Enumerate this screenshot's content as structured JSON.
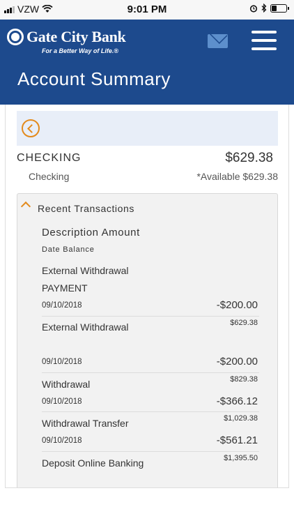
{
  "status_bar": {
    "carrier": "VZW",
    "time": "9:01 PM",
    "battery_level": 0.35,
    "icons": [
      "signal-icon",
      "wifi-icon",
      "alarm-icon",
      "bluetooth-icon",
      "battery-icon"
    ]
  },
  "brand": {
    "bank_name": "Gate City Bank",
    "tagline": "For a Better Way of Life.®",
    "color": "#1d4a8d",
    "accent": "#e38a1c"
  },
  "header": {
    "title": "Account Summary"
  },
  "account": {
    "name": "CHECKING",
    "balance": "$629.38",
    "type": "Checking",
    "available": "*Available $629.38"
  },
  "transactions": {
    "heading": "Recent Transactions",
    "columns_line1": "Description Amount",
    "columns_line2": "Date Balance",
    "items": [
      {
        "description_line1": "External Withdrawal",
        "description_line2": "PAYMENT",
        "date": "09/10/2018",
        "amount": "-$200.00",
        "balance": "$629.38"
      },
      {
        "description_line1": "External Withdrawal",
        "description_line2": "",
        "date": "09/10/2018",
        "amount": "-$200.00",
        "balance": "$829.38"
      },
      {
        "description_line1": "Withdrawal",
        "description_line2": "",
        "date": "09/10/2018",
        "amount": "-$366.12",
        "balance": "$1,029.38"
      },
      {
        "description_line1": "Withdrawal Transfer",
        "description_line2": "",
        "date": "09/10/2018",
        "amount": "-$561.21",
        "balance": "$1,395.50"
      },
      {
        "description_line1": "Deposit Online Banking",
        "description_line2": "",
        "date": "",
        "amount": "",
        "balance": ""
      }
    ]
  }
}
